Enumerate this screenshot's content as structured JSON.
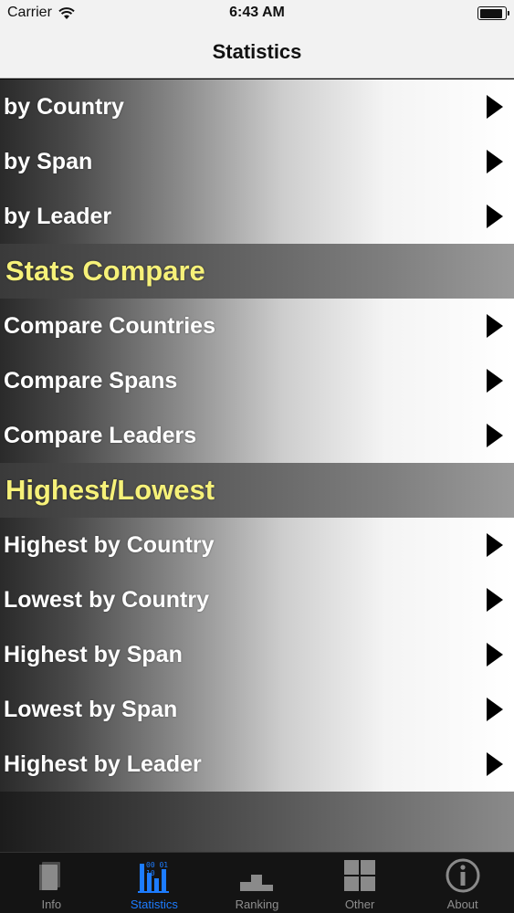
{
  "status_bar": {
    "carrier": "Carrier",
    "time": "6:43 AM",
    "battery_level": 0.95
  },
  "nav": {
    "title": "Statistics"
  },
  "menu_group_1": [
    {
      "label": "by Country"
    },
    {
      "label": "by Span"
    },
    {
      "label": "by Leader"
    }
  ],
  "section_compare": {
    "title": "Stats Compare"
  },
  "menu_group_2": [
    {
      "label": "Compare Countries"
    },
    {
      "label": "Compare Spans"
    },
    {
      "label": "Compare Leaders"
    }
  ],
  "section_highlow": {
    "title": "Highest/Lowest"
  },
  "menu_group_3": [
    {
      "label": "Highest by Country"
    },
    {
      "label": "Lowest by Country"
    },
    {
      "label": "Highest by Span"
    },
    {
      "label": "Lowest by Span"
    },
    {
      "label": "Highest by Leader"
    }
  ],
  "tabs": [
    {
      "label": "Info",
      "icon": "book-icon"
    },
    {
      "label": "Statistics",
      "icon": "statistics-icon",
      "active": true
    },
    {
      "label": "Ranking",
      "icon": "podium-icon"
    },
    {
      "label": "Other",
      "icon": "grid-icon"
    },
    {
      "label": "About",
      "icon": "info-icon"
    }
  ],
  "colors": {
    "section_text": "#f6f179",
    "tab_active": "#1d7cff",
    "tab_inactive": "#8e8e8e",
    "nav_background": "#f2f2f2"
  }
}
